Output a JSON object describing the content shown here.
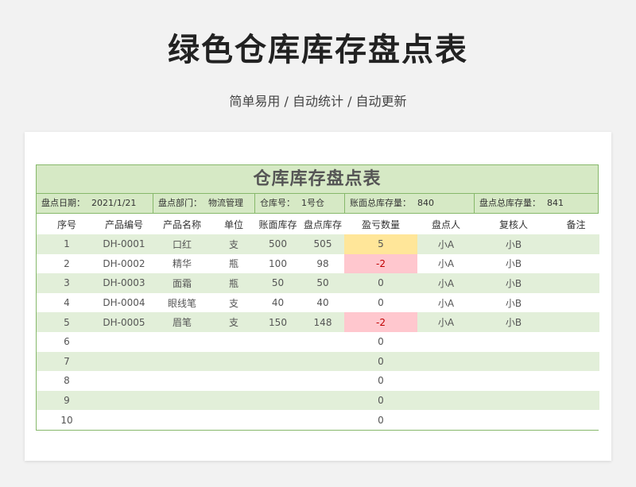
{
  "header": {
    "title": "绿色仓库库存盘点表",
    "subtitle": "简单易用  /  自动统计  /  自动更新"
  },
  "sheet": {
    "title": "仓库库存盘点表",
    "info": {
      "date_label": "盘点日期：",
      "date_value": "2021/1/21",
      "dept_label": "盘点部门：",
      "dept_value": "物流管理",
      "warehouse_label": "仓库号：",
      "warehouse_value": "1号仓",
      "book_total_label": "账面总库存量：",
      "book_total_value": "840",
      "count_total_label": "盘点总库存量：",
      "count_total_value": "841"
    },
    "columns": [
      "序号",
      "产品编号",
      "产品名称",
      "单位",
      "账面库存",
      "盘点库存",
      "盈亏数量",
      "盘点人",
      "复核人",
      "备注"
    ],
    "rows": [
      [
        "1",
        "DH-0001",
        "口红",
        "支",
        "500",
        "505",
        "5",
        "小A",
        "小B",
        ""
      ],
      [
        "2",
        "DH-0002",
        "精华",
        "瓶",
        "100",
        "98",
        "-2",
        "小A",
        "小B",
        ""
      ],
      [
        "3",
        "DH-0003",
        "面霜",
        "瓶",
        "50",
        "50",
        "0",
        "小A",
        "小B",
        ""
      ],
      [
        "4",
        "DH-0004",
        "眼线笔",
        "支",
        "40",
        "40",
        "0",
        "小A",
        "小B",
        ""
      ],
      [
        "5",
        "DH-0005",
        "眉笔",
        "支",
        "150",
        "148",
        "-2",
        "小A",
        "小B",
        ""
      ],
      [
        "6",
        "",
        "",
        "",
        "",
        "",
        "0",
        "",
        "",
        ""
      ],
      [
        "7",
        "",
        "",
        "",
        "",
        "",
        "0",
        "",
        "",
        ""
      ],
      [
        "8",
        "",
        "",
        "",
        "",
        "",
        "0",
        "",
        "",
        ""
      ],
      [
        "9",
        "",
        "",
        "",
        "",
        "",
        "0",
        "",
        "",
        ""
      ],
      [
        "10",
        "",
        "",
        "",
        "",
        "",
        "0",
        "",
        "",
        ""
      ]
    ],
    "colors": {
      "header_green": "#d6e9c5",
      "row_green": "#e2efd9",
      "border_green": "#86b86a",
      "positive_fill": "#ffe699",
      "negative_fill": "#ffc7ce",
      "negative_text": "#c00000"
    }
  }
}
